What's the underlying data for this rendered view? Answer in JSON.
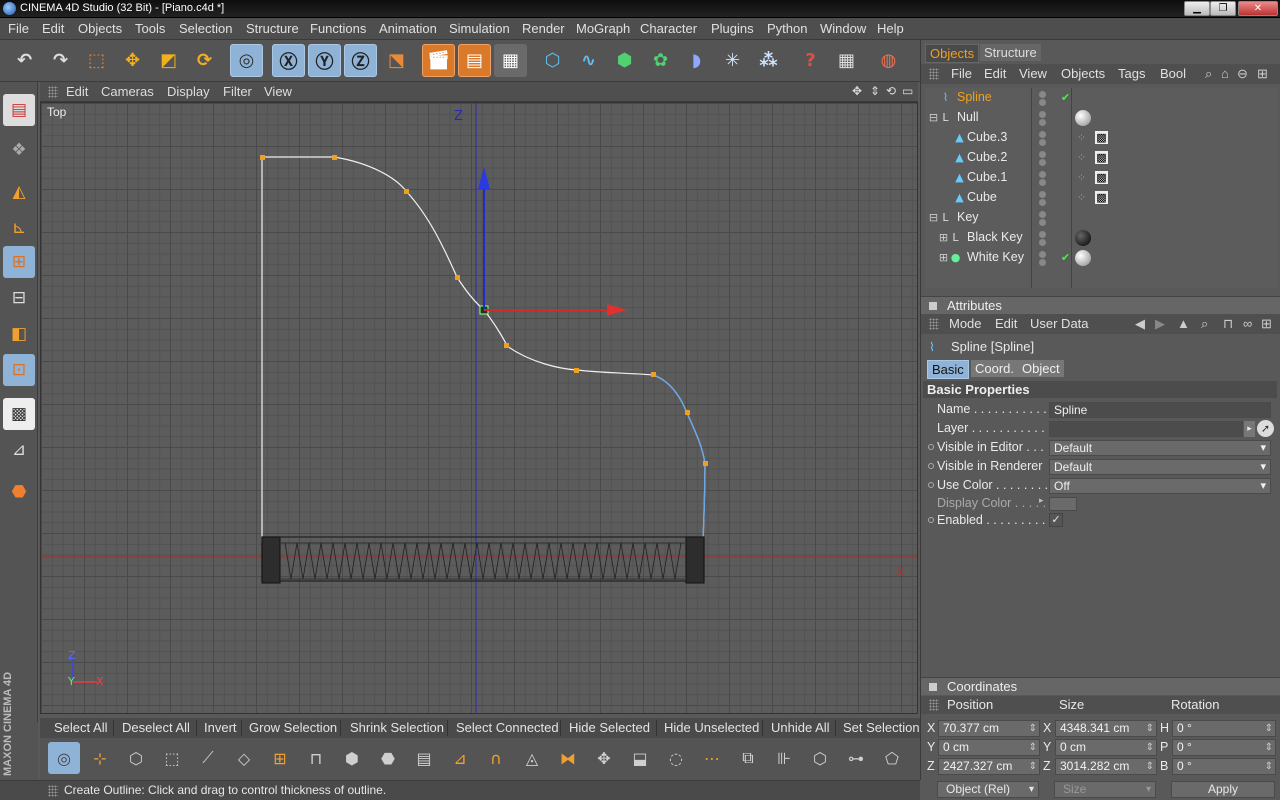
{
  "window": {
    "title": "CINEMA 4D Studio (32 Bit) - [Piano.c4d *]"
  },
  "menubar": [
    "File",
    "Edit",
    "Objects",
    "Tools",
    "Selection",
    "Structure",
    "Functions",
    "Animation",
    "Simulation",
    "Render",
    "MoGraph",
    "Character",
    "Plugins",
    "Python",
    "Window",
    "Help"
  ],
  "viewport": {
    "menu": [
      "Edit",
      "Cameras",
      "Display",
      "Filter",
      "View"
    ],
    "label": "Top",
    "axis_z": "Z",
    "axis_x": "X",
    "mini_axis_z": "Z",
    "mini_axis_y": "Y",
    "mini_axis_x": "X"
  },
  "selection_bar": [
    "Select All",
    "Deselect All",
    "Invert",
    "Grow Selection",
    "Shrink Selection",
    "Select Connected",
    "Hide Selected",
    "Hide Unselected",
    "Unhide All",
    "Set Selection"
  ],
  "brand": "MAXON CINEMA 4D",
  "status": "Create Outline: Click and drag to control thickness of outline.",
  "objects_panel": {
    "tabs": [
      "Objects",
      "Structure"
    ],
    "menu": [
      "File",
      "Edit",
      "View",
      "Objects",
      "Tags",
      "Bool"
    ],
    "tree": [
      "Spline",
      "Null",
      "Cube.3",
      "Cube.2",
      "Cube.1",
      "Cube",
      "Key",
      "Black Key",
      "White Key"
    ]
  },
  "attributes_panel": {
    "header": "Attributes",
    "menu": [
      "Mode",
      "Edit",
      "User Data"
    ],
    "object_title": "Spline [Spline]",
    "tabs": [
      "Basic",
      "Coord.",
      "Object"
    ],
    "section": "Basic Properties",
    "labels": {
      "name": "Name . . . . . . . . . . . .",
      "layer": "Layer . . . . . . . . . . . .",
      "visible_editor": "Visible in Editor . . .",
      "visible_renderer": "Visible in Renderer",
      "use_color": "Use Color . . . . . . . .",
      "display_color": "Display Color . . . . .",
      "enabled": "Enabled . . . . . . . . ."
    },
    "values": {
      "name": "Spline",
      "visible_editor": "Default",
      "visible_renderer": "Default",
      "use_color": "Off",
      "enabled": "✓"
    }
  },
  "coordinates_panel": {
    "header": "Coordinates",
    "col_headers": [
      "Position",
      "Size",
      "Rotation"
    ],
    "rows": [
      {
        "pl": "X",
        "pv": "70.377 cm",
        "sl": "X",
        "sv": "4348.341 cm",
        "rl": "H",
        "rv": "0 °"
      },
      {
        "pl": "Y",
        "pv": "0 cm",
        "sl": "Y",
        "sv": "0 cm",
        "rl": "P",
        "rv": "0 °"
      },
      {
        "pl": "Z",
        "pv": "2427.327 cm",
        "sl": "Z",
        "sv": "3014.282 cm",
        "rl": "B",
        "rv": "0 °"
      }
    ],
    "mode": "Object (Rel)",
    "size_mode": "Size",
    "apply": "Apply"
  }
}
